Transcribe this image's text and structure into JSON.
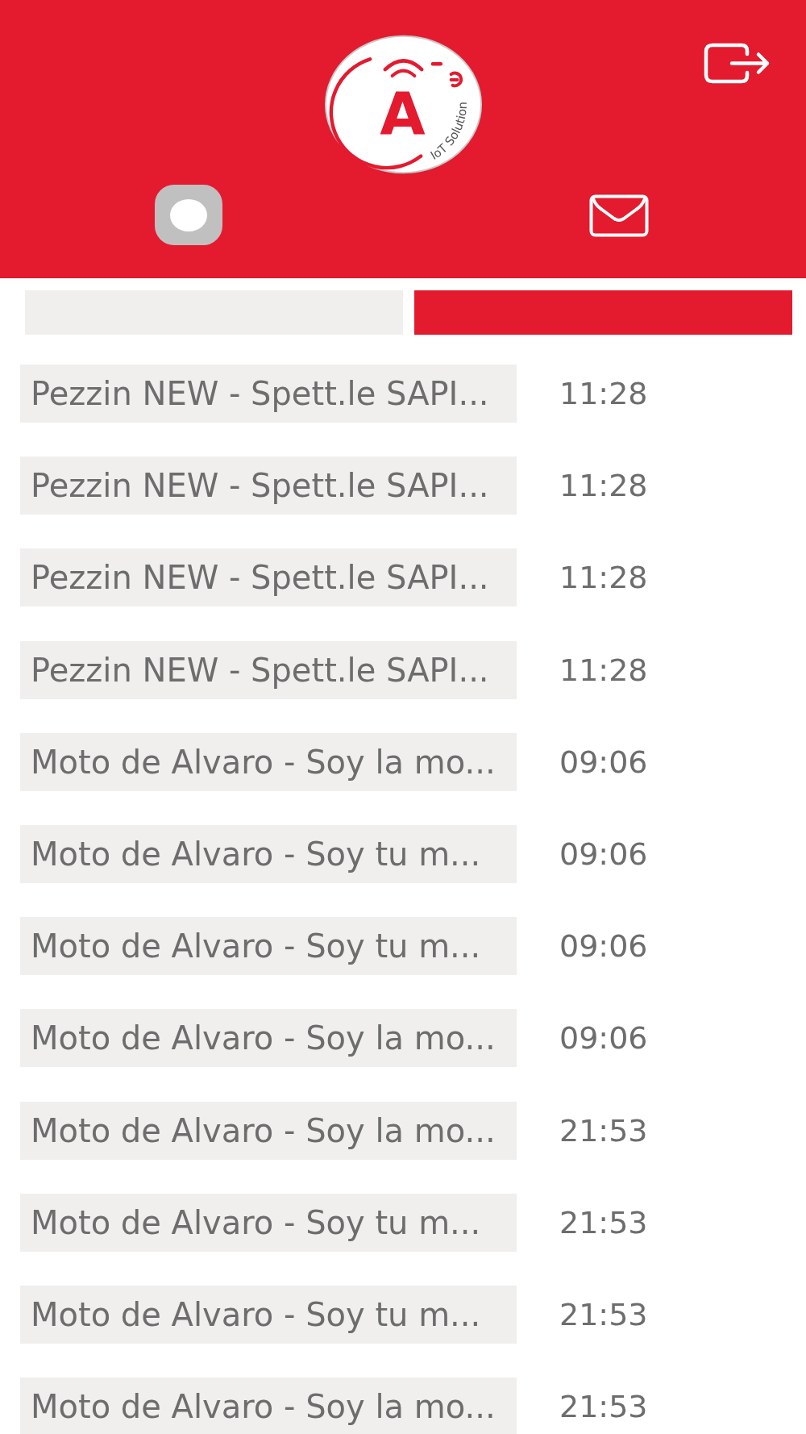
{
  "header": {
    "logo": {
      "letter": "A",
      "tagline": "IoT Solution"
    },
    "toggle": {
      "on": false
    }
  },
  "tabs": [
    {
      "selected": false
    },
    {
      "selected": true
    }
  ],
  "messages": [
    {
      "title": "Pezzin NEW - Spett.le SAPI...",
      "time": "11:28"
    },
    {
      "title": "Pezzin NEW - Spett.le SAPI...",
      "time": "11:28"
    },
    {
      "title": "Pezzin NEW - Spett.le SAPI...",
      "time": "11:28"
    },
    {
      "title": "Pezzin NEW - Spett.le SAPI...",
      "time": "11:28"
    },
    {
      "title": "Moto de Alvaro - Soy la mo...",
      "time": "09:06"
    },
    {
      "title": "Moto de Alvaro - Soy tu m...",
      "time": "09:06"
    },
    {
      "title": "Moto de Alvaro - Soy tu m...",
      "time": "09:06"
    },
    {
      "title": "Moto de Alvaro - Soy la mo...",
      "time": "09:06"
    },
    {
      "title": "Moto de Alvaro - Soy la mo...",
      "time": "21:53"
    },
    {
      "title": "Moto de Alvaro - Soy tu m...",
      "time": "21:53"
    },
    {
      "title": "Moto de Alvaro - Soy tu m...",
      "time": "21:53"
    },
    {
      "title": "Moto de Alvaro - Soy la mo...",
      "time": "21:53"
    }
  ]
}
